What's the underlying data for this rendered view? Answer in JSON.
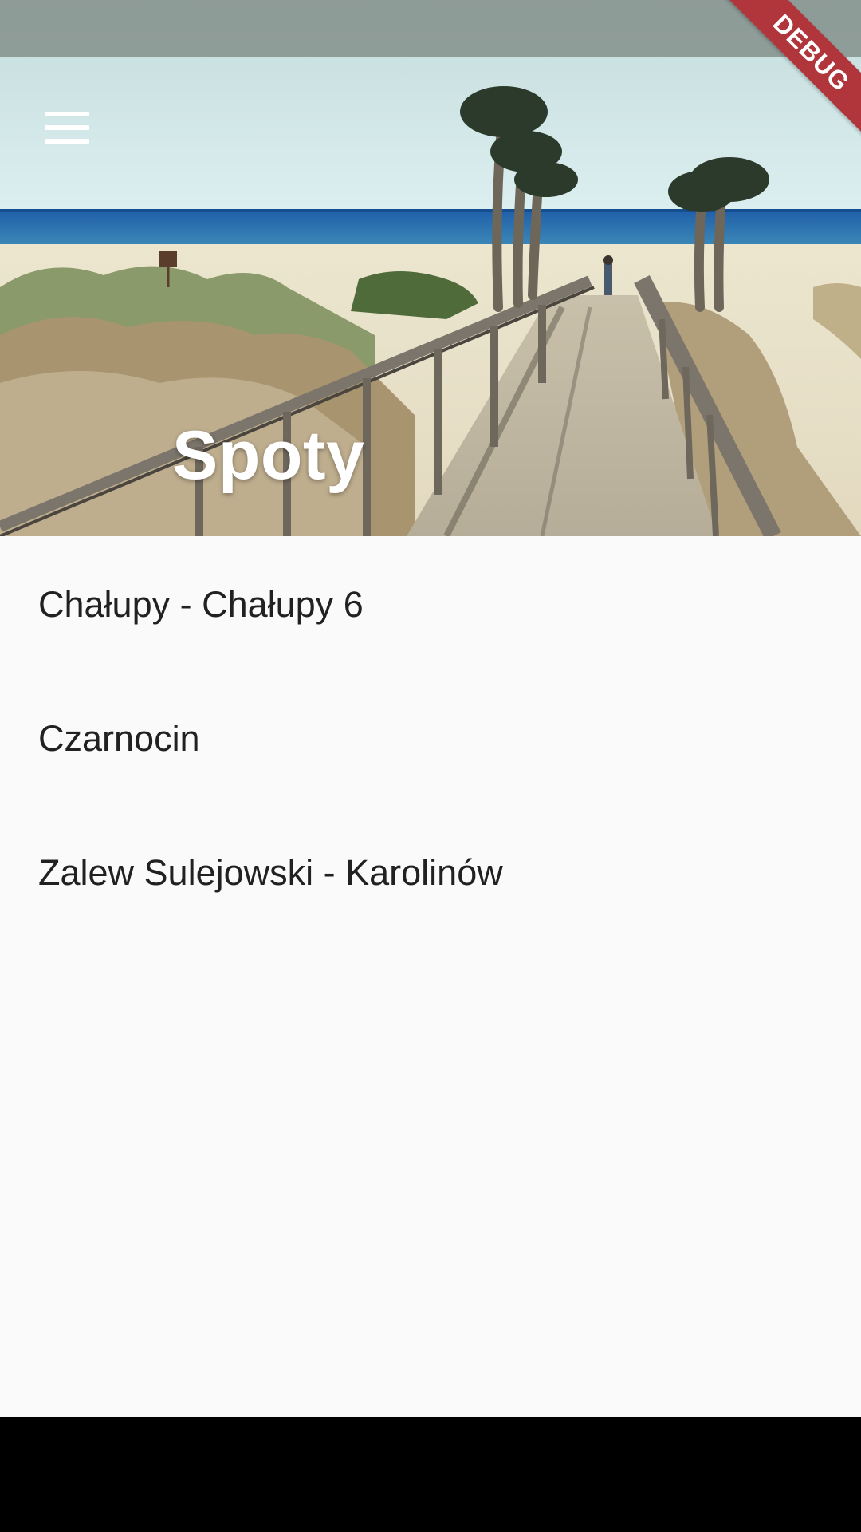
{
  "header": {
    "title": "Spoty",
    "menu_icon": "menu-icon"
  },
  "debug_banner": {
    "label": "DEBUG",
    "color": "#b0363c"
  },
  "spots": [
    {
      "label": "Chałupy - Chałupy 6"
    },
    {
      "label": "Czarnocin"
    },
    {
      "label": "Zalew Sulejowski - Karolinów"
    }
  ],
  "colors": {
    "background": "#fafafa",
    "text": "#212121",
    "title": "#ffffff"
  }
}
